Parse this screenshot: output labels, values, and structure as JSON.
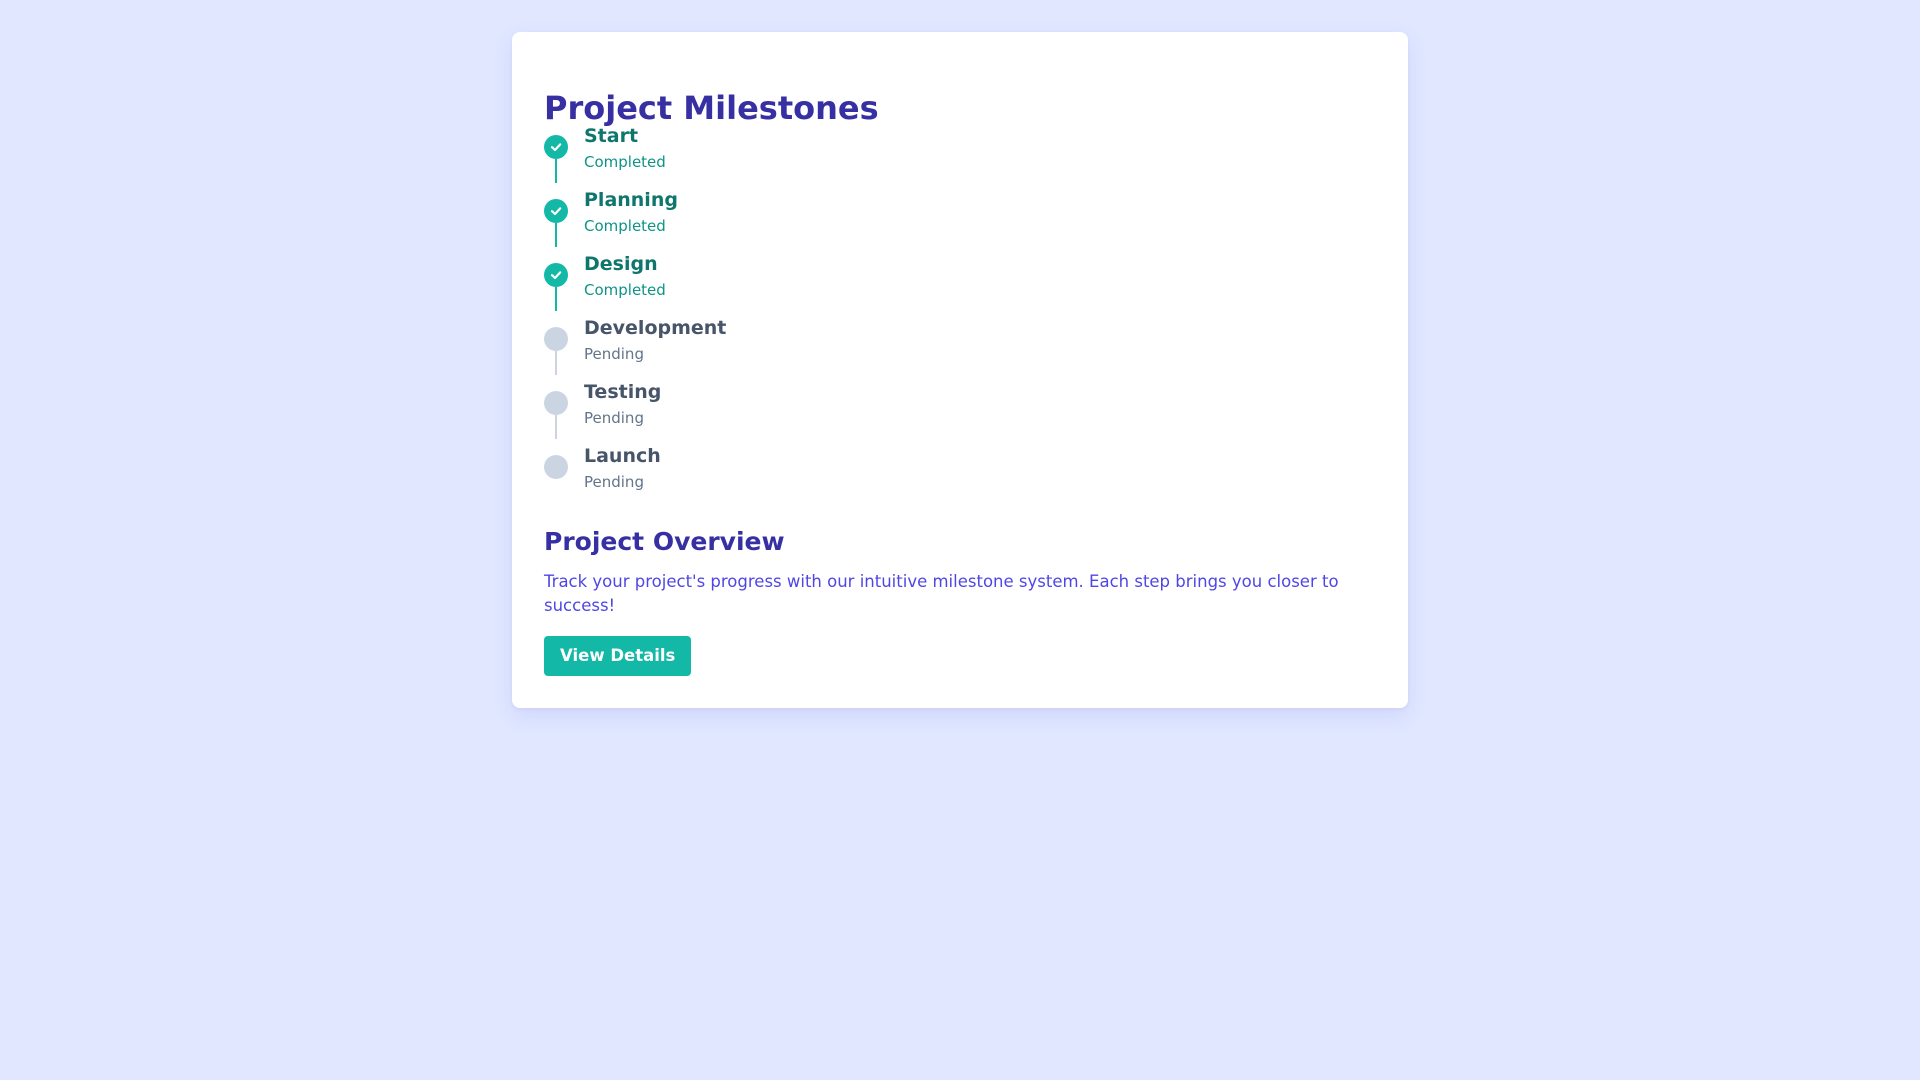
{
  "card": {
    "title": "Project Milestones",
    "milestones": [
      {
        "name": "Start",
        "status": "Completed",
        "done": true
      },
      {
        "name": "Planning",
        "status": "Completed",
        "done": true
      },
      {
        "name": "Design",
        "status": "Completed",
        "done": true
      },
      {
        "name": "Development",
        "status": "Pending",
        "done": false
      },
      {
        "name": "Testing",
        "status": "Pending",
        "done": false
      },
      {
        "name": "Launch",
        "status": "Pending",
        "done": false
      }
    ],
    "overview": {
      "title": "Project Overview",
      "text": "Track your project's progress with our intuitive milestone system. Each step brings you closer to success!",
      "button_label": "View Details"
    }
  },
  "icons": {
    "completed": "check-icon",
    "pending": "circle-icon"
  },
  "colors": {
    "background": "#e0e7ff",
    "accent": "#14b8a6",
    "heading": "#3730a3",
    "body_text": "#4f46e5",
    "pending": "#cbd5e1"
  }
}
